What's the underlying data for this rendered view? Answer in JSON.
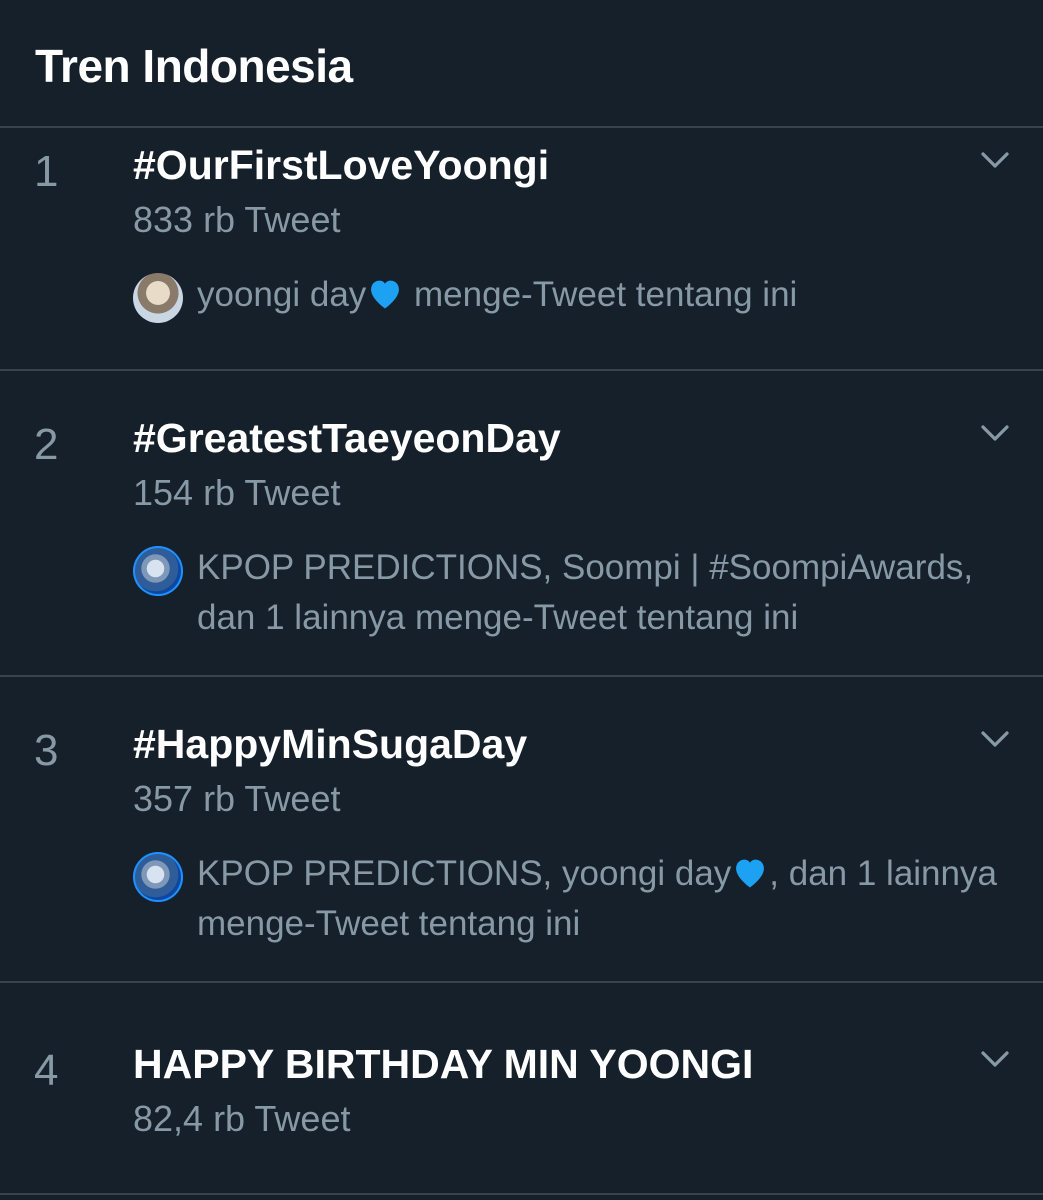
{
  "header": {
    "title": "Tren Indonesia"
  },
  "trends": [
    {
      "rank": "1",
      "name": "#OurFirstLoveYoongi",
      "count": "833 rb Tweet",
      "context_before": "yoongi day",
      "context_after": " menge-Tweet tentang ini"
    },
    {
      "rank": "2",
      "name": "#GreatestTaeyeonDay",
      "count": "154 rb Tweet",
      "context_text": "KPOP PREDICTIONS, Soompi | #SoompiAwards, dan 1 lainnya menge-Tweet tentang ini"
    },
    {
      "rank": "3",
      "name": "#HappyMinSugaDay",
      "count": "357 rb Tweet",
      "context_before": "KPOP PREDICTIONS, yoongi day",
      "context_after": ", dan 1 lainnya menge-Tweet tentang ini"
    },
    {
      "rank": "4",
      "name": "HAPPY BIRTHDAY MIN YOONGI",
      "count": "82,4 rb Tweet"
    }
  ],
  "icons": {
    "chevron": "chevron-down-icon",
    "heart": "blue-heart-emoji"
  },
  "colors": {
    "background": "#15202b",
    "divider": "#38444d",
    "secondary_text": "#8899a6",
    "primary_text": "#ffffff",
    "heart": "#1da1f2"
  }
}
